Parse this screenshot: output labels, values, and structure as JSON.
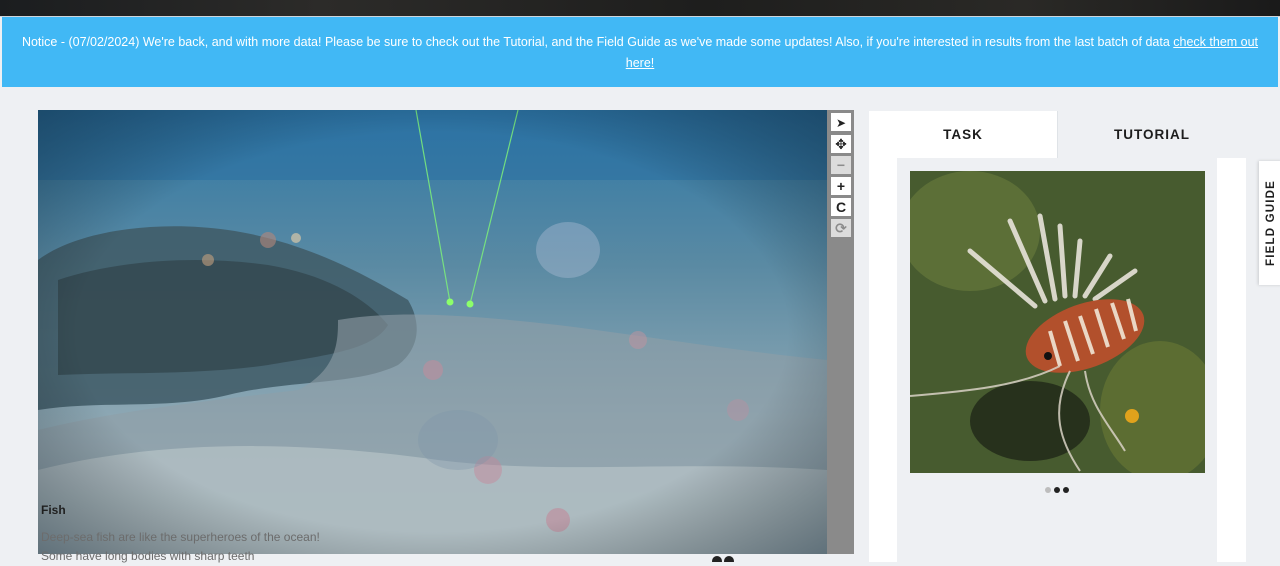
{
  "notice": {
    "text": "Notice - (07/02/2024) We're back, and with more data! Please be sure to check out the Tutorial, and the Field Guide as we've made some updates! Also, if you're interested in results from the last batch of data ",
    "link_text": "check them out here!"
  },
  "toolbar": {
    "tools": [
      {
        "name": "annotate",
        "glyph": "➤"
      },
      {
        "name": "pan",
        "glyph": "✥"
      },
      {
        "name": "zoom-out",
        "glyph": "−"
      },
      {
        "name": "zoom-in",
        "glyph": "+"
      },
      {
        "name": "rotate",
        "glyph": "C"
      },
      {
        "name": "reset",
        "glyph": "⟳"
      }
    ]
  },
  "task_panel": {
    "tabs": {
      "task": "TASK",
      "tutorial": "TUTORIAL"
    },
    "active_tab": "TASK",
    "guide_item": {
      "title": "Fish",
      "text": "Deep-sea fish are like the superheroes of the ocean! Some have long bodies with sharp teeth",
      "carousel": {
        "total": 3,
        "active_index": 1
      }
    }
  },
  "field_guide": {
    "label": "FIELD GUIDE"
  },
  "colors": {
    "notice_bg": "#41b8f5",
    "toolbar_bg": "#8a8a8a",
    "page_bg": "#eef0f3"
  }
}
